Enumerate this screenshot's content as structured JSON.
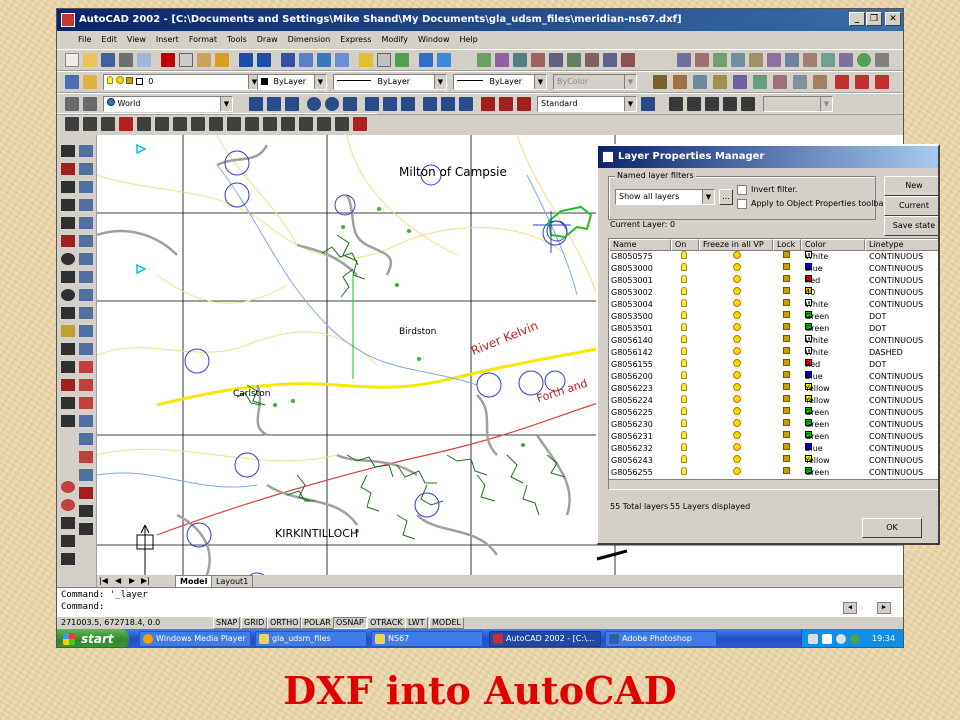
{
  "window": {
    "title": "AutoCAD 2002 - [C:\\Documents and Settings\\Mike Shand\\My Documents\\gla_udsm_files\\meridian-ns67.dxf]",
    "minimize": "_",
    "restore": "❐",
    "close": "✕"
  },
  "menu": [
    "File",
    "Edit",
    "View",
    "Insert",
    "Format",
    "Tools",
    "Draw",
    "Dimension",
    "Express",
    "Modify",
    "Window",
    "Help"
  ],
  "properties_toolbar": {
    "layer_value": "0",
    "color_value": "ByLayer",
    "linetype_value": "ByLayer",
    "lineweight_value": "ByLayer",
    "plotstyle_value": "ByColor"
  },
  "ucs_toolbar": {
    "ucs_value": "World",
    "dimstyle_value": "Standard"
  },
  "map_labels": {
    "milton": "Milton of Campsie",
    "birdston": "Birdston",
    "carlston": "Carlston",
    "kelvin": "River Kelvin",
    "forth": "Forth and",
    "kirk": "KIRKINTILLOCH"
  },
  "layout_tabs": {
    "model": "Model",
    "layout1": "Layout1"
  },
  "command_lines": {
    "line1": "Command: '_layer",
    "line2": "Command:"
  },
  "status": {
    "coords": "271003.5, 672718.4, 0.0",
    "snap": "SNAP",
    "grid": "GRID",
    "ortho": "ORTHO",
    "polar": "POLAR",
    "osnap": "OSNAP",
    "otrack": "OTRACK",
    "lwt": "LWT",
    "model": "MODEL"
  },
  "taskbar": {
    "start": "start",
    "items": [
      "Windows Media Player",
      "gla_udsm_files",
      "NS67",
      "AutoCAD 2002 - [C:\\...",
      "Adobe Photoshop"
    ],
    "clock": "19:34"
  },
  "dialog": {
    "title": "Layer Properties Manager",
    "filters_label": "Named layer filters",
    "filter_value": "Show all layers",
    "browse": "...",
    "invert_filter": "Invert filter.",
    "apply_toolbar": "Apply to Object Properties toolbar.",
    "current_layer": "Current Layer:  0",
    "buttons": {
      "new": "New",
      "current": "Current",
      "save_state": "Save state",
      "ok": "OK"
    },
    "columns": [
      "Name",
      "On",
      "Freeze in all VP",
      "Lock",
      "Color",
      "Linetype"
    ],
    "rows": [
      {
        "name": "G8050575",
        "color": "White",
        "linetype": "CONTINUOUS"
      },
      {
        "name": "G8053000",
        "color": "Blue",
        "linetype": "CONTINUOUS"
      },
      {
        "name": "G8053001",
        "color": "Red",
        "linetype": "CONTINUOUS"
      },
      {
        "name": "G8053002",
        "color": "40",
        "linetype": "CONTINUOUS"
      },
      {
        "name": "G8053004",
        "color": "White",
        "linetype": "CONTINUOUS"
      },
      {
        "name": "G8053500",
        "color": "Green",
        "linetype": "DOT"
      },
      {
        "name": "G8053501",
        "color": "Green",
        "linetype": "DOT"
      },
      {
        "name": "G8056140",
        "color": "White",
        "linetype": "CONTINUOUS"
      },
      {
        "name": "G8056142",
        "color": "White",
        "linetype": "DASHED"
      },
      {
        "name": "G8056155",
        "color": "Red",
        "linetype": "DOT"
      },
      {
        "name": "G8056200",
        "color": "Blue",
        "linetype": "CONTINUOUS"
      },
      {
        "name": "G8056223",
        "color": "Yellow",
        "linetype": "CONTINUOUS"
      },
      {
        "name": "G8056224",
        "color": "Yellow",
        "linetype": "CONTINUOUS"
      },
      {
        "name": "G8056225",
        "color": "Green",
        "linetype": "CONTINUOUS"
      },
      {
        "name": "G8056230",
        "color": "Green",
        "linetype": "CONTINUOUS"
      },
      {
        "name": "G8056231",
        "color": "Green",
        "linetype": "CONTINUOUS"
      },
      {
        "name": "G8056232",
        "color": "Blue",
        "linetype": "CONTINUOUS"
      },
      {
        "name": "G8056243",
        "color": "Yellow",
        "linetype": "CONTINUOUS"
      },
      {
        "name": "G8056255",
        "color": "Green",
        "linetype": "CONTINUOUS"
      }
    ],
    "swatches": {
      "White": "#ffffff",
      "Blue": "#0000ff",
      "Red": "#ff0000",
      "40": "#ffbf00",
      "Green": "#00c800",
      "Yellow": "#ffff00"
    },
    "total_layers": "55 Total layers",
    "displayed_layers": "55 Layers displayed"
  },
  "caption": "DXF into AutoCAD"
}
